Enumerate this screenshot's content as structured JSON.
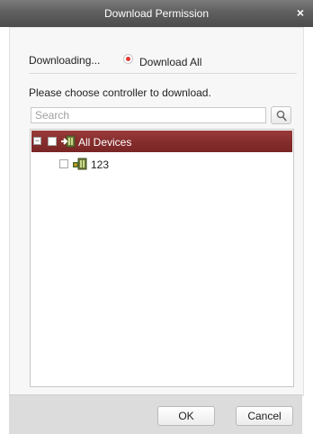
{
  "window": {
    "title": "Download Permission",
    "close_glyph": "×"
  },
  "download": {
    "label": "Downloading...",
    "option_label": "Download All",
    "option_selected": true
  },
  "controller": {
    "prompt": "Please choose controller to download."
  },
  "search": {
    "placeholder": "Search",
    "value": "",
    "icon": "search-icon"
  },
  "tree": {
    "root": {
      "label": "All Devices",
      "expanded": true,
      "checked": false,
      "icon": "device-group-icon"
    },
    "children": [
      {
        "label": "123",
        "checked": false,
        "icon": "access-controller-icon"
      }
    ],
    "selected_color": "#862d2d"
  },
  "footer": {
    "ok_label": "OK",
    "cancel_label": "Cancel"
  }
}
